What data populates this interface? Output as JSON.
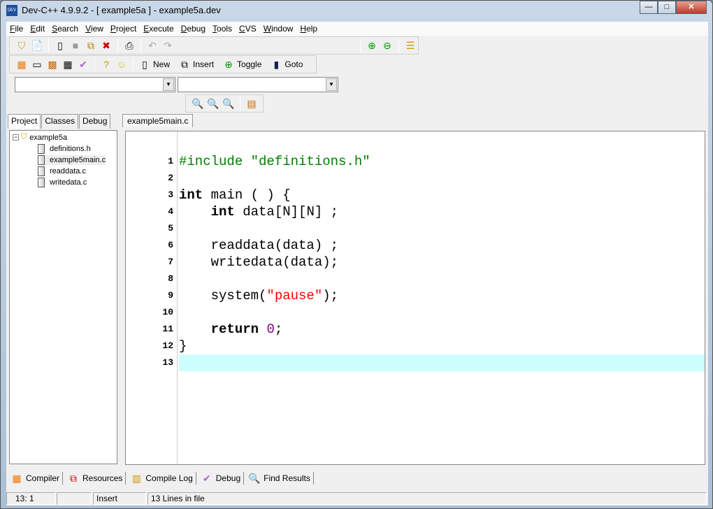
{
  "window": {
    "title": "Dev-C++ 4.9.9.2  - [ example5a ] - example5a.dev",
    "minimize": "—",
    "maximize": "□",
    "close": "✕",
    "app_icon": "dev-cpp-icon"
  },
  "menu": [
    "File",
    "Edit",
    "Search",
    "View",
    "Project",
    "Execute",
    "Debug",
    "Tools",
    "CVS",
    "Window",
    "Help"
  ],
  "toolbar2": {
    "new": "New",
    "insert": "Insert",
    "toggle": "Toggle",
    "goto": "Goto"
  },
  "left_tabs": [
    "Project",
    "Classes",
    "Debug"
  ],
  "tree": {
    "root": "example5a",
    "files": [
      "definitions.h",
      "example5main.c",
      "readdata.c",
      "writedata.c"
    ]
  },
  "editor_tab": "example5main.c",
  "code": [
    [
      {
        "t": "#include ",
        "c": "pp"
      },
      {
        "t": "\"definitions.h\"",
        "c": "inc"
      }
    ],
    [],
    [
      {
        "t": "int",
        "c": "kw"
      },
      {
        "t": " main ( ) {",
        "c": ""
      }
    ],
    [
      {
        "t": "    ",
        "c": ""
      },
      {
        "t": "int",
        "c": "kw"
      },
      {
        "t": " data[N][N] ;",
        "c": ""
      }
    ],
    [],
    [
      {
        "t": "    readdata(data) ;",
        "c": ""
      }
    ],
    [
      {
        "t": "    writedata(data);",
        "c": ""
      }
    ],
    [],
    [
      {
        "t": "    system(",
        "c": ""
      },
      {
        "t": "\"pause\"",
        "c": "str"
      },
      {
        "t": ");",
        "c": ""
      }
    ],
    [],
    [
      {
        "t": "    ",
        "c": ""
      },
      {
        "t": "return",
        "c": "kw"
      },
      {
        "t": " ",
        "c": ""
      },
      {
        "t": "0",
        "c": "num"
      },
      {
        "t": ";",
        "c": ""
      }
    ],
    [
      {
        "t": "}",
        "c": ""
      }
    ],
    []
  ],
  "current_line": 13,
  "bottom_tabs": [
    {
      "label": "Compiler",
      "icon": "compiler-icon"
    },
    {
      "label": "Resources",
      "icon": "resources-icon"
    },
    {
      "label": "Compile Log",
      "icon": "compile-log-icon"
    },
    {
      "label": "Debug",
      "icon": "debug-check-icon"
    },
    {
      "label": "Find Results",
      "icon": "find-results-icon"
    }
  ],
  "status": {
    "position": "13: 1",
    "blank": "",
    "mode": "Insert",
    "lines": "13 Lines in file"
  }
}
